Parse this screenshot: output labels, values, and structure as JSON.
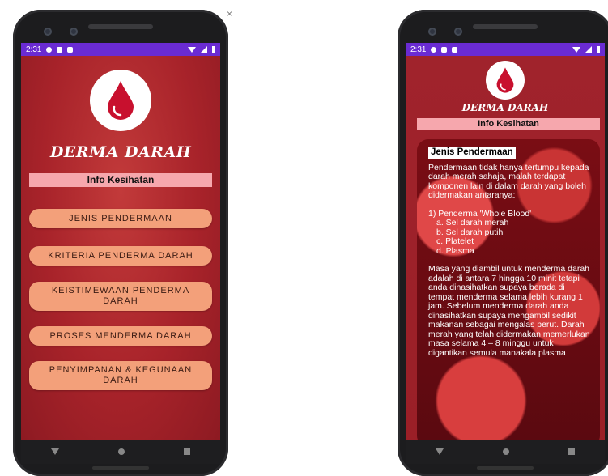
{
  "close_glyph": "×",
  "left_phone": {
    "status": {
      "time": "2:31"
    },
    "brand": "DERMA DARAH",
    "info_label": "Info Kesihatan",
    "menu": [
      "JENIS PENDERMAAN",
      "KRITERIA PENDERMA DARAH",
      "KEISTIMEWAAN PENDERMA DARAH",
      "PROSES MENDERMA DARAH",
      "PENYIMPANAN & KEGUNAAN DARAH"
    ]
  },
  "right_phone": {
    "status": {
      "time": "2:31"
    },
    "brand": "DERMA DARAH",
    "info_label": "Info Kesihatan",
    "article": {
      "title": "Jenis Pendermaan",
      "intro": "Pendermaan tidak hanya tertumpu kepada darah merah sahaja, malah terdapat komponen lain di dalam darah yang boleh didermakan antaranya:",
      "list_heading": "1) Penderma 'Whole Blood'",
      "list_items": [
        "a. Sel darah merah",
        "b. Sel darah putih",
        "c. Platelet",
        "d. Plasma"
      ],
      "body": "Masa yang diambil untuk menderma darah adalah di antara 7 hingga 10 minit tetapi anda dinasihatkan supaya berada di tempat menderma selama lebih kurang 1 jam. Sebelum menderma darah anda dinasihatkan supaya mengambil sedikit makanan sebagai mengalas perut. Darah merah yang telah didermakan memerlukan masa selama 4 – 8 minggu untuk digantikan semula manakala plasma"
    }
  },
  "colors": {
    "status_bar": "#6a2bd3",
    "app_bg": "#a8232a",
    "info_bar": "#f6a7ad",
    "menu_button": "#f3a07a",
    "drop": "#c8102e"
  },
  "icons": [
    "settings-icon",
    "shield-icon",
    "sd-card-icon",
    "wifi-icon",
    "signal-icon",
    "battery-icon",
    "back-icon",
    "home-icon",
    "recents-icon",
    "blood-drop-icon",
    "close-icon"
  ]
}
